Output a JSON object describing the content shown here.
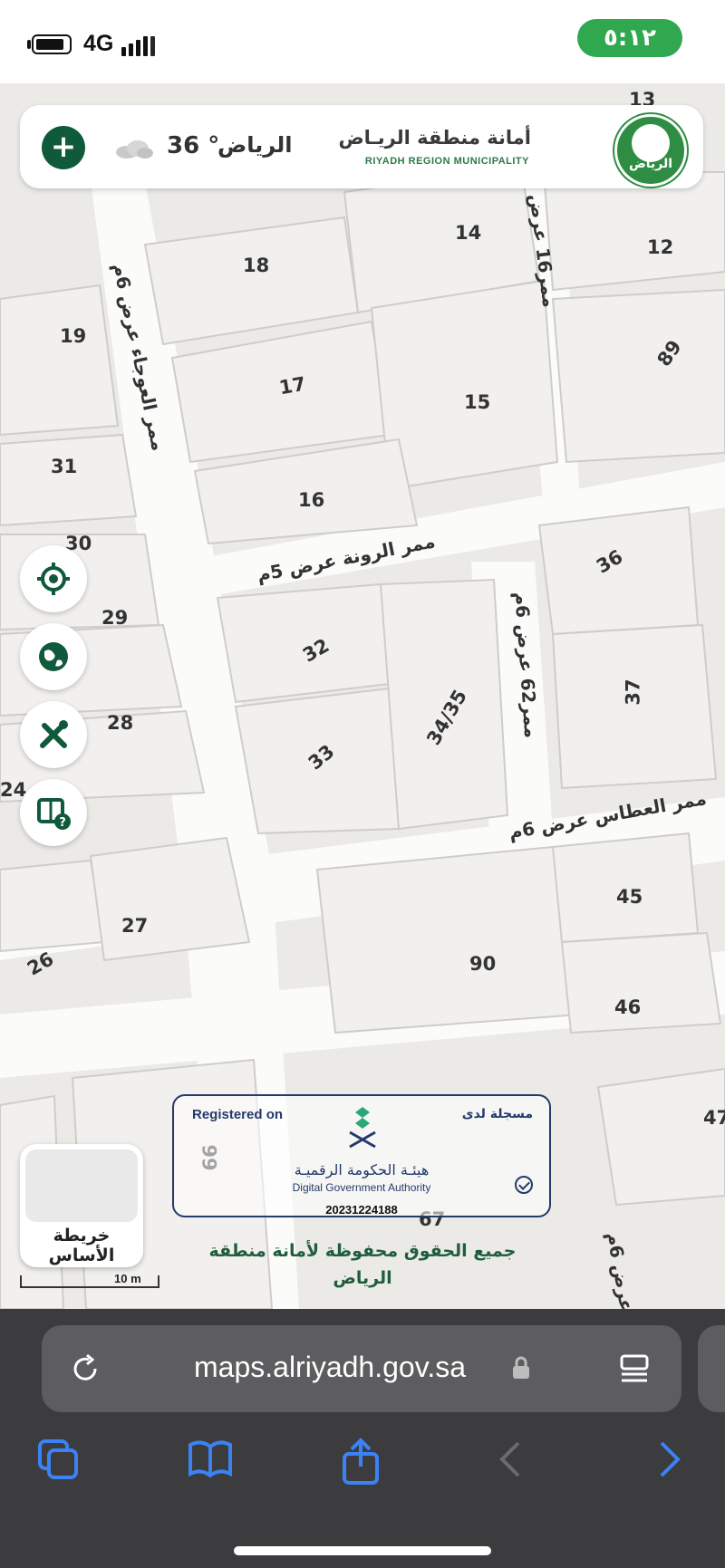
{
  "status_bar": {
    "network": "4G",
    "time": "٥:١٢"
  },
  "header": {
    "city": "الرياض",
    "temperature": "36 °",
    "municipality_ar": "أمانة منطقة الريـاض",
    "municipality_en": "RIYADH REGION MUNICIPALITY",
    "logo_text": "الرياض"
  },
  "map": {
    "plots": [
      "13",
      "14",
      "12",
      "18",
      "19",
      "89",
      "17",
      "15",
      "31",
      "16",
      "30",
      "36",
      "29",
      "32",
      "28",
      "34/35",
      "37",
      "33",
      "24",
      "27",
      "45",
      "26",
      "90",
      "46",
      "99",
      "67",
      "47"
    ],
    "streets": [
      "ممر العوجاء عرض 6م",
      "ممر16 عرض 6م",
      "ممر الرونة عرض 5م",
      "ممر62 عرض 6م",
      "ممر العطاس عرض 6م",
      "عرض 6م"
    ]
  },
  "basemap": {
    "label": "خريطة الأساس",
    "scale": "10 m"
  },
  "watermark": {
    "registered_en": "Registered on",
    "registered_ar": "مسجلة لدى",
    "authority_ar": "هيئـة الحكومة الرقميـة",
    "authority_en": "Digital Government Authority",
    "number": "20231224188"
  },
  "rights": "جميع الحقوق محفوظة لأمانة منطقة الرياض",
  "browser": {
    "url": "maps.alriyadh.gov.sa"
  },
  "colors": {
    "accent_green": "#0f5a3a",
    "status_green": "#2fa84f",
    "browser_blue": "#3b82f6"
  }
}
